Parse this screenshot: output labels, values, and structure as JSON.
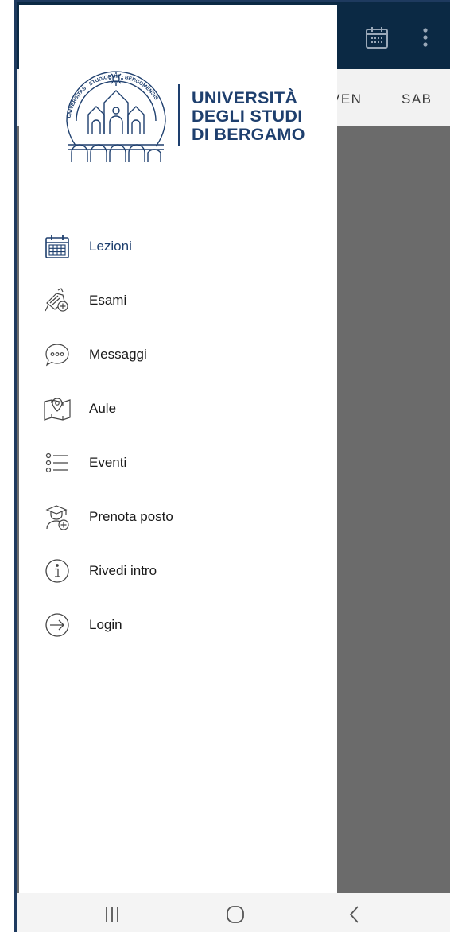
{
  "app": {
    "days": {
      "ven": "VEN",
      "sab": "SAB"
    }
  },
  "drawer": {
    "logo": {
      "line1": "UNIVERSITÀ",
      "line2": "DEGLI STUDI",
      "line3": "DI BERGAMO",
      "seal_text": "UNIVERSITAS STUDIORUM BERGOMENSIS"
    },
    "menu": [
      {
        "label": "Lezioni",
        "icon": "calendar-icon",
        "active": true
      },
      {
        "label": "Esami",
        "icon": "exam-pen-icon"
      },
      {
        "label": "Messaggi",
        "icon": "chat-bubble-icon"
      },
      {
        "label": "Aule",
        "icon": "map-pin-icon"
      },
      {
        "label": "Eventi",
        "icon": "list-icon"
      },
      {
        "label": "Prenota posto",
        "icon": "graduate-add-icon"
      },
      {
        "label": "Rivedi intro",
        "icon": "info-icon"
      },
      {
        "label": "Login",
        "icon": "login-arrow-icon"
      }
    ]
  },
  "colors": {
    "brand": "#1e3f6e",
    "header": "#0b2944",
    "scrim": "#6b6b6b"
  }
}
